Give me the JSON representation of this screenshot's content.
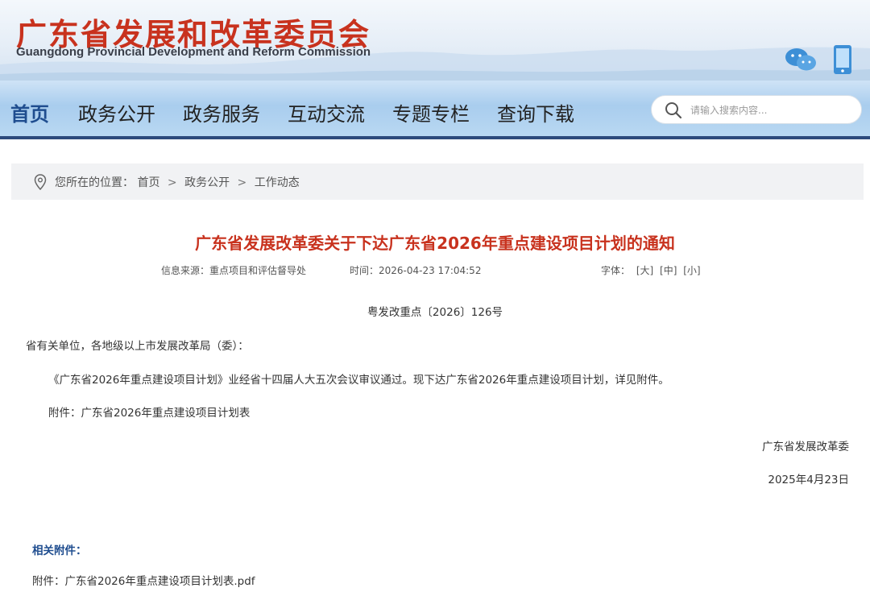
{
  "header": {
    "title": "广东省发展和改革委员会",
    "subtitle": "Guangdong Provincial Development and Reform Commission",
    "icons": [
      "wechat-icon",
      "mobile-icon"
    ]
  },
  "nav": {
    "items": [
      "首页",
      "政务公开",
      "政务服务",
      "互动交流",
      "专题专栏",
      "查询下载"
    ],
    "active_index": 0
  },
  "search": {
    "placeholder": "请输入搜索内容..."
  },
  "breadcrumb": {
    "prefix": "您所在的位置：",
    "items": [
      "首页",
      "政务公开",
      "工作动态"
    ],
    "separator": ">"
  },
  "article": {
    "title": "广东省发展改革委关于下达广东省2026年重点建设项目计划的通知",
    "source": "信息来源：重点项目和评估督导处",
    "time": "时间：2026-04-23 17:04:52",
    "font_label": "字体：",
    "font_options": [
      "[大]",
      "[中]",
      "[小]"
    ],
    "doc_number": "粤发改重点〔2026〕126号",
    "salutation": "省有关单位，各地级以上市发展改革局（委）：",
    "body": "《广东省2026年重点建设项目计划》业经省十四届人大五次会议审议通过。现下达广东省2026年重点建设项目计划，详见附件。",
    "attachment_line": "附件：广东省2026年重点建设项目计划表",
    "signature": "广东省发展改革委",
    "date": "2025年4月23日"
  },
  "attachments": {
    "heading": "相关附件：",
    "file": "附件：广东省2026年重点建设项目计划表.pdf"
  },
  "colors": {
    "title_red": "#c8321e",
    "nav_active": "#1f4d8f",
    "nav_border": "#2d4a7c",
    "attach_heading": "#1f4d8f"
  }
}
